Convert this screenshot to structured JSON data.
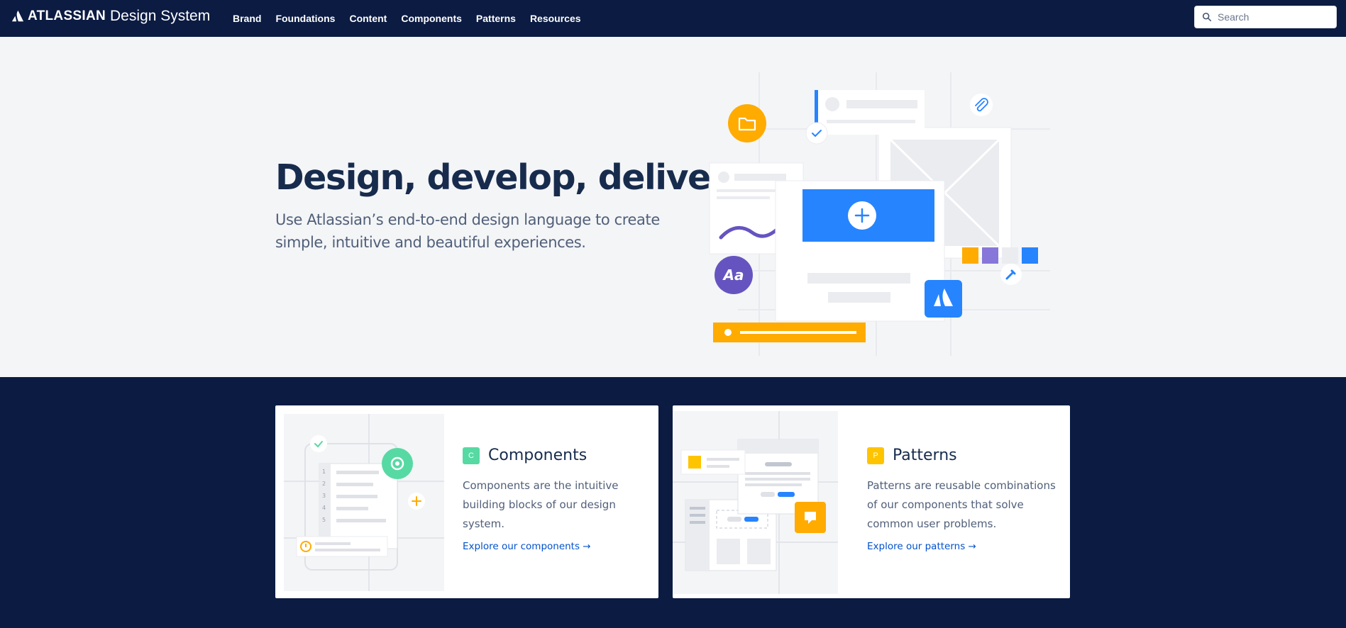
{
  "nav": {
    "logo_word": "ATLASSIAN",
    "logo_sub": "Design System",
    "links": [
      "Brand",
      "Foundations",
      "Content",
      "Components",
      "Patterns",
      "Resources"
    ],
    "search_placeholder": "Search",
    "search_value": ""
  },
  "hero": {
    "title": "Design, develop, deliver",
    "subtitle": "Use Atlassian’s end-to-end design language to create simple, intuitive and beautiful experiences.",
    "art_typeface_label": "Aa"
  },
  "cards": [
    {
      "badge": "C",
      "title": "Components",
      "description": "Components are the intuitive building blocks of our design system.",
      "link": "Explore our components →",
      "art_numbers": [
        "1",
        "2",
        "3",
        "4",
        "5"
      ]
    },
    {
      "badge": "P",
      "title": "Patterns",
      "description": "Patterns are reusable combinations of our components that solve common user problems.",
      "link": "Explore our patterns →"
    }
  ],
  "colors": {
    "navy": "#0b1b42",
    "hero_bg": "#f4f5f7",
    "blue": "#2684ff",
    "yellow": "#ffab00",
    "purple": "#6554c0",
    "green": "#57d9a3",
    "link": "#0052cc"
  },
  "icons": [
    "atlassian-logo-icon",
    "search-icon",
    "folder-icon",
    "paperclip-icon",
    "check-icon",
    "plus-icon",
    "typeface-icon",
    "pen-icon",
    "settings-icon",
    "warning-icon",
    "comment-icon",
    "arrow-right-icon"
  ]
}
